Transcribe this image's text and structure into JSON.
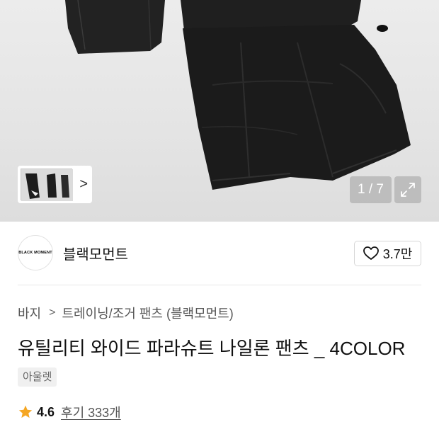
{
  "gallery": {
    "current": 1,
    "total": 7,
    "counter_text": "1 / 7",
    "next_label": ">"
  },
  "brand": {
    "logo_text": "BLACK MOMENT",
    "name": "블랙모먼트",
    "like_count": "3.7만"
  },
  "breadcrumb": {
    "items": [
      "바지",
      "트레이닝/조거 팬츠 (블랙모먼트)"
    ],
    "separator": ">"
  },
  "product": {
    "title": "유틸리티 와이드 파라슈트 나일론 팬츠 _ 4COLOR",
    "tag": "아울렛"
  },
  "rating": {
    "score": "4.6",
    "reviews_text": "후기 333개",
    "star_color": "#f5a623"
  },
  "colors": {
    "like_heart": "#111111",
    "divider": "#e6e6e6"
  }
}
